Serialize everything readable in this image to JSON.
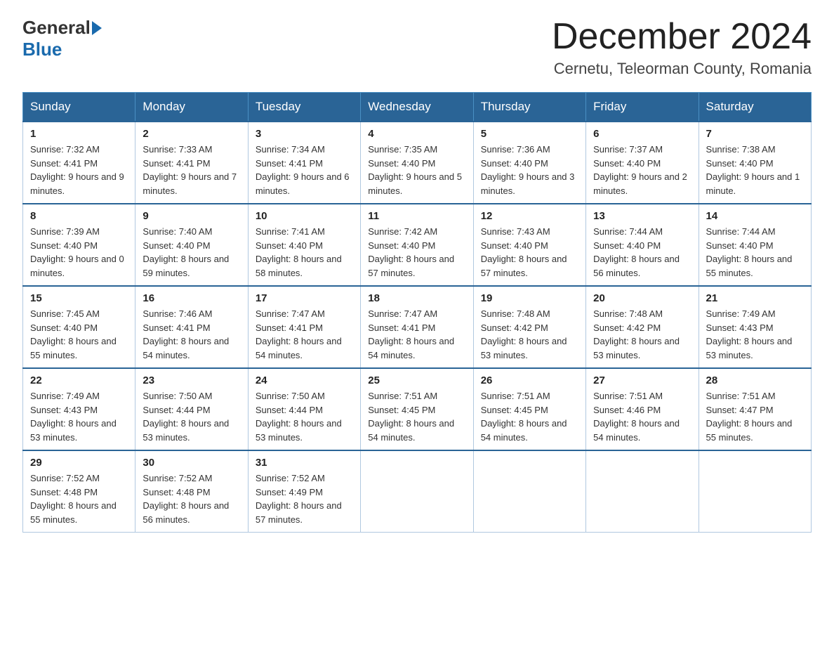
{
  "header": {
    "logo_general": "General",
    "logo_blue": "Blue",
    "title": "December 2024",
    "subtitle": "Cernetu, Teleorman County, Romania"
  },
  "calendar": {
    "days_of_week": [
      "Sunday",
      "Monday",
      "Tuesday",
      "Wednesday",
      "Thursday",
      "Friday",
      "Saturday"
    ],
    "weeks": [
      [
        {
          "day": "1",
          "sunrise": "7:32 AM",
          "sunset": "4:41 PM",
          "daylight": "9 hours and 9 minutes."
        },
        {
          "day": "2",
          "sunrise": "7:33 AM",
          "sunset": "4:41 PM",
          "daylight": "9 hours and 7 minutes."
        },
        {
          "day": "3",
          "sunrise": "7:34 AM",
          "sunset": "4:41 PM",
          "daylight": "9 hours and 6 minutes."
        },
        {
          "day": "4",
          "sunrise": "7:35 AM",
          "sunset": "4:40 PM",
          "daylight": "9 hours and 5 minutes."
        },
        {
          "day": "5",
          "sunrise": "7:36 AM",
          "sunset": "4:40 PM",
          "daylight": "9 hours and 3 minutes."
        },
        {
          "day": "6",
          "sunrise": "7:37 AM",
          "sunset": "4:40 PM",
          "daylight": "9 hours and 2 minutes."
        },
        {
          "day": "7",
          "sunrise": "7:38 AM",
          "sunset": "4:40 PM",
          "daylight": "9 hours and 1 minute."
        }
      ],
      [
        {
          "day": "8",
          "sunrise": "7:39 AM",
          "sunset": "4:40 PM",
          "daylight": "9 hours and 0 minutes."
        },
        {
          "day": "9",
          "sunrise": "7:40 AM",
          "sunset": "4:40 PM",
          "daylight": "8 hours and 59 minutes."
        },
        {
          "day": "10",
          "sunrise": "7:41 AM",
          "sunset": "4:40 PM",
          "daylight": "8 hours and 58 minutes."
        },
        {
          "day": "11",
          "sunrise": "7:42 AM",
          "sunset": "4:40 PM",
          "daylight": "8 hours and 57 minutes."
        },
        {
          "day": "12",
          "sunrise": "7:43 AM",
          "sunset": "4:40 PM",
          "daylight": "8 hours and 57 minutes."
        },
        {
          "day": "13",
          "sunrise": "7:44 AM",
          "sunset": "4:40 PM",
          "daylight": "8 hours and 56 minutes."
        },
        {
          "day": "14",
          "sunrise": "7:44 AM",
          "sunset": "4:40 PM",
          "daylight": "8 hours and 55 minutes."
        }
      ],
      [
        {
          "day": "15",
          "sunrise": "7:45 AM",
          "sunset": "4:40 PM",
          "daylight": "8 hours and 55 minutes."
        },
        {
          "day": "16",
          "sunrise": "7:46 AM",
          "sunset": "4:41 PM",
          "daylight": "8 hours and 54 minutes."
        },
        {
          "day": "17",
          "sunrise": "7:47 AM",
          "sunset": "4:41 PM",
          "daylight": "8 hours and 54 minutes."
        },
        {
          "day": "18",
          "sunrise": "7:47 AM",
          "sunset": "4:41 PM",
          "daylight": "8 hours and 54 minutes."
        },
        {
          "day": "19",
          "sunrise": "7:48 AM",
          "sunset": "4:42 PM",
          "daylight": "8 hours and 53 minutes."
        },
        {
          "day": "20",
          "sunrise": "7:48 AM",
          "sunset": "4:42 PM",
          "daylight": "8 hours and 53 minutes."
        },
        {
          "day": "21",
          "sunrise": "7:49 AM",
          "sunset": "4:43 PM",
          "daylight": "8 hours and 53 minutes."
        }
      ],
      [
        {
          "day": "22",
          "sunrise": "7:49 AM",
          "sunset": "4:43 PM",
          "daylight": "8 hours and 53 minutes."
        },
        {
          "day": "23",
          "sunrise": "7:50 AM",
          "sunset": "4:44 PM",
          "daylight": "8 hours and 53 minutes."
        },
        {
          "day": "24",
          "sunrise": "7:50 AM",
          "sunset": "4:44 PM",
          "daylight": "8 hours and 53 minutes."
        },
        {
          "day": "25",
          "sunrise": "7:51 AM",
          "sunset": "4:45 PM",
          "daylight": "8 hours and 54 minutes."
        },
        {
          "day": "26",
          "sunrise": "7:51 AM",
          "sunset": "4:45 PM",
          "daylight": "8 hours and 54 minutes."
        },
        {
          "day": "27",
          "sunrise": "7:51 AM",
          "sunset": "4:46 PM",
          "daylight": "8 hours and 54 minutes."
        },
        {
          "day": "28",
          "sunrise": "7:51 AM",
          "sunset": "4:47 PM",
          "daylight": "8 hours and 55 minutes."
        }
      ],
      [
        {
          "day": "29",
          "sunrise": "7:52 AM",
          "sunset": "4:48 PM",
          "daylight": "8 hours and 55 minutes."
        },
        {
          "day": "30",
          "sunrise": "7:52 AM",
          "sunset": "4:48 PM",
          "daylight": "8 hours and 56 minutes."
        },
        {
          "day": "31",
          "sunrise": "7:52 AM",
          "sunset": "4:49 PM",
          "daylight": "8 hours and 57 minutes."
        },
        null,
        null,
        null,
        null
      ]
    ]
  }
}
